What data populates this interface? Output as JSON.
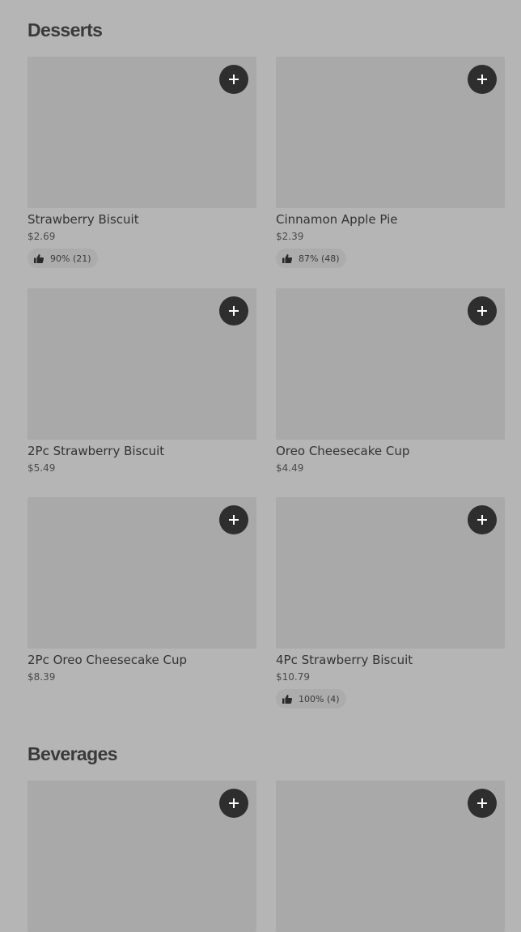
{
  "sections": [
    {
      "title": "Desserts",
      "items": [
        {
          "name": "Strawberry Biscuit",
          "price": "$2.69",
          "rating": "90% (21)"
        },
        {
          "name": "Cinnamon Apple Pie",
          "price": "$2.39",
          "rating": "87% (48)"
        },
        {
          "name": "2Pc Strawberry Biscuit",
          "price": "$5.49",
          "rating": null
        },
        {
          "name": "Oreo Cheesecake Cup",
          "price": "$4.49",
          "rating": null
        },
        {
          "name": "2Pc Oreo Cheesecake Cup",
          "price": "$8.39",
          "rating": null
        },
        {
          "name": "4Pc Strawberry Biscuit",
          "price": "$10.79",
          "rating": "100% (4)"
        }
      ]
    },
    {
      "title": "Beverages",
      "items": [
        {
          "name": "",
          "price": "",
          "rating": null
        },
        {
          "name": "",
          "price": "",
          "rating": null
        }
      ]
    }
  ],
  "icons": {
    "add": "plus-icon",
    "rating": "thumbs-up-icon"
  },
  "colors": {
    "background": "#b5b5b5",
    "image_placeholder": "#a9a9a9",
    "add_button": "#2e2e2e",
    "rating_pill": "#acacac"
  }
}
